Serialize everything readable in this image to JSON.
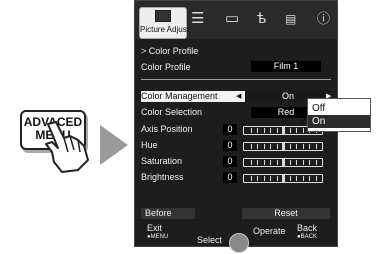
{
  "remote": {
    "line1": "ADVACED",
    "line2": "MENU"
  },
  "osd": {
    "tabs": {
      "active_label": "Picture Adjust"
    },
    "header": "> Color Profile",
    "color_profile": {
      "label": "Color Profile",
      "value": "Film 1"
    },
    "color_management": {
      "label": "Color Management",
      "value": "On"
    },
    "color_selection": {
      "label": "Color Selection",
      "value": "Red"
    },
    "sliders": [
      {
        "label": "Axis Position",
        "value": "0"
      },
      {
        "label": "Hue",
        "value": "0"
      },
      {
        "label": "Saturation",
        "value": "0"
      },
      {
        "label": "Brightness",
        "value": "0"
      }
    ],
    "buttons": {
      "before": "Before",
      "reset": "Reset"
    },
    "footer": {
      "exit": "Exit",
      "exit_sub": "●MENU",
      "select": "Select",
      "operate": "Operate",
      "back": "Back",
      "back_sub": "●BACK"
    }
  },
  "popup": {
    "options": [
      "Off",
      "On"
    ],
    "selected": "On"
  }
}
